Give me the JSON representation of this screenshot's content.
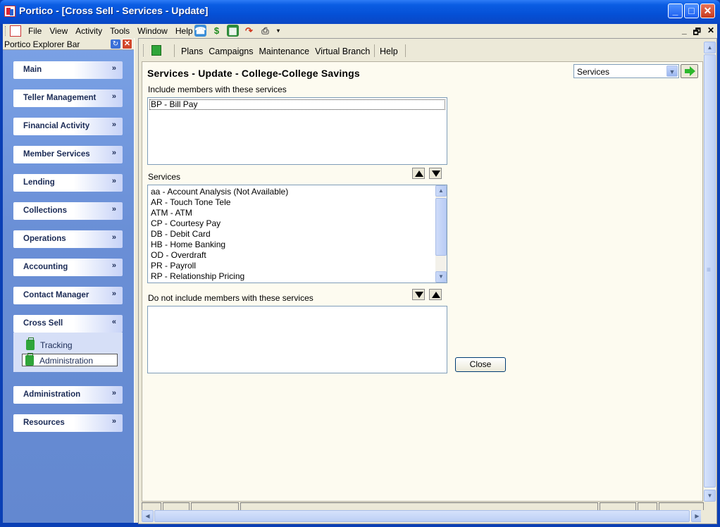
{
  "window": {
    "title": "Portico - [Cross Sell - Services - Update]",
    "minimize": "_",
    "maximize": "□",
    "close": "✕"
  },
  "menubar": {
    "items": [
      "File",
      "View",
      "Activity",
      "Tools",
      "Window",
      "Help"
    ],
    "mdi_min": "_",
    "mdi_restore": "🗗",
    "mdi_close": "✕"
  },
  "explorer": {
    "title": "Portico Explorer Bar",
    "pin": "↻",
    "close": "✕",
    "groups": [
      {
        "label": "Main",
        "chevron": "»"
      },
      {
        "label": "Teller Management",
        "chevron": "»"
      },
      {
        "label": "Financial Activity",
        "chevron": "»"
      },
      {
        "label": "Member Services",
        "chevron": "»"
      },
      {
        "label": "Lending",
        "chevron": "»"
      },
      {
        "label": "Collections",
        "chevron": "»"
      },
      {
        "label": "Operations",
        "chevron": "»"
      },
      {
        "label": "Accounting",
        "chevron": "»"
      },
      {
        "label": "Contact Manager",
        "chevron": "»"
      },
      {
        "label": "Cross Sell",
        "chevron": "«"
      },
      {
        "label": "Administration",
        "chevron": "»"
      },
      {
        "label": "Resources",
        "chevron": "»"
      }
    ],
    "cross_sell_items": [
      {
        "label": "Tracking"
      },
      {
        "label": "Administration"
      }
    ]
  },
  "toolbar": {
    "links": [
      "Plans",
      "Campaigns",
      "Maintenance",
      "Virtual Branch"
    ],
    "help": "Help"
  },
  "page": {
    "title": "Services - Update - College-College Savings",
    "view_select": "Services",
    "include_label": "Include members with these services",
    "include_items": [
      "BP - Bill Pay"
    ],
    "services_label": "Services",
    "services_items": [
      "aa - Account Analysis (Not Available)",
      "AR - Touch Tone Tele",
      "ATM - ATM",
      "CP - Courtesy Pay",
      "DB - Debit Card",
      "HB - Home Banking",
      "OD - Overdraft",
      "PR - Payroll",
      "RP - Relationship Pricing"
    ],
    "exclude_label": "Do not include members with these services",
    "exclude_items": [],
    "close_button": "Close"
  }
}
